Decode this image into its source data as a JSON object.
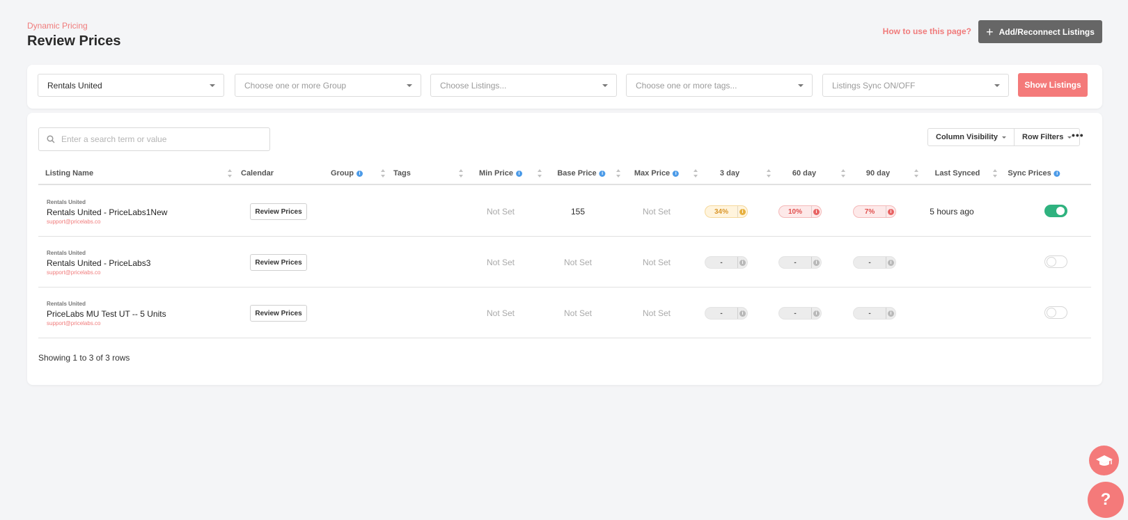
{
  "header": {
    "eyebrow": "Dynamic Pricing",
    "title": "Review Prices",
    "howto_link": "How to use this page?",
    "add_button": "Add/Reconnect Listings"
  },
  "filters": {
    "pms": "Rentals United",
    "group_placeholder": "Choose one or more Group",
    "listings_placeholder": "Choose Listings...",
    "tags_placeholder": "Choose one or more tags...",
    "sync_placeholder": "Listings Sync ON/OFF",
    "show_button": "Show Listings"
  },
  "toolbar": {
    "search_placeholder": "Enter a search term or value",
    "column_visibility": "Column Visibility",
    "row_filters": "Row Filters",
    "more": "•••"
  },
  "columns": {
    "listing_name": "Listing Name",
    "calendar": "Calendar",
    "group": "Group",
    "tags": "Tags",
    "min_price": "Min Price",
    "base_price": "Base Price",
    "max_price": "Max Price",
    "day3": "3 day",
    "day60": "60 day",
    "day90": "90 day",
    "last_synced": "Last Synced",
    "sync_prices": "Sync Prices"
  },
  "rows": [
    {
      "source": "Rentals United",
      "name": "Rentals United - PriceLabs1New",
      "email": "support@pricelabs.co",
      "review": "Review Prices",
      "min": "Not Set",
      "base": "155",
      "max": "Not Set",
      "d3": "34%",
      "d60": "10%",
      "d90": "7%",
      "last_synced": "5 hours ago",
      "sync_on": true
    },
    {
      "source": "Rentals United",
      "name": "Rentals United - PriceLabs3",
      "email": "support@pricelabs.co",
      "review": "Review Prices",
      "min": "Not Set",
      "base": "Not Set",
      "max": "Not Set",
      "d3": "-",
      "d60": "-",
      "d90": "-",
      "last_synced": "",
      "sync_on": false
    },
    {
      "source": "Rentals United",
      "name": "PriceLabs MU Test UT -- 5 Units",
      "email": "support@pricelabs.co",
      "review": "Review Prices",
      "min": "Not Set",
      "base": "Not Set",
      "max": "Not Set",
      "d3": "-",
      "d60": "-",
      "d90": "-",
      "last_synced": "",
      "sync_on": false
    }
  ],
  "footer": {
    "summary": "Showing 1 to 3 of 3 rows"
  },
  "fab": {
    "help": "?"
  },
  "colors": {
    "accent": "#f47a7a",
    "toggle_on": "#2fb27f",
    "dark_button": "#666666"
  }
}
